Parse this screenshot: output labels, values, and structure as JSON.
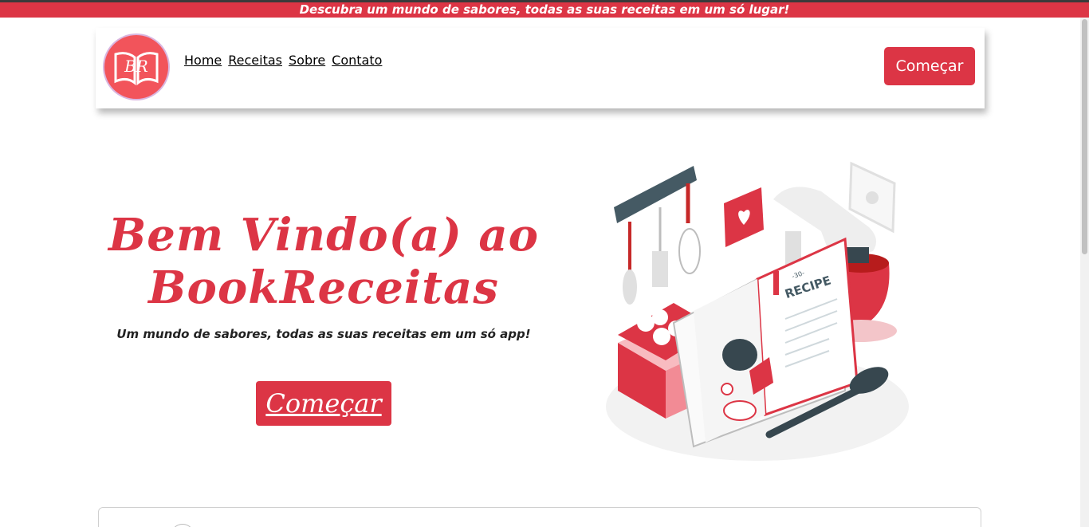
{
  "banner": {
    "text": "Descubra um mundo de sabores, todas as suas receitas em um só lugar!"
  },
  "navbar": {
    "logo_text": "BR",
    "links": [
      "Home",
      "Receitas",
      "Sobre",
      "Contato"
    ],
    "cta_label": "Começar"
  },
  "hero": {
    "title_line1": "Bem Vindo(a) ao",
    "title_line2": "BookReceitas",
    "subtitle": "Um mundo de sabores, todas as suas receitas em um só app!",
    "cta_label": "Começar"
  },
  "illustration": {
    "book_label": "RECIPE",
    "book_number": "-30-"
  },
  "colors": {
    "accent": "#dc3545",
    "logo_bg": "#f2545b",
    "dark": "#37474f"
  }
}
